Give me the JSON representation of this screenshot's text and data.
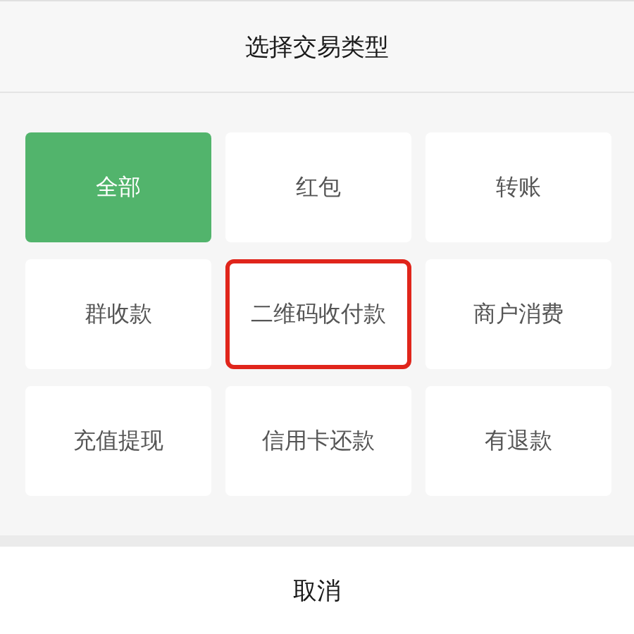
{
  "title": "选择交易类型",
  "options": [
    {
      "label": "全部",
      "selected": true,
      "highlighted": false
    },
    {
      "label": "红包",
      "selected": false,
      "highlighted": false
    },
    {
      "label": "转账",
      "selected": false,
      "highlighted": false
    },
    {
      "label": "群收款",
      "selected": false,
      "highlighted": false
    },
    {
      "label": "二维码收付款",
      "selected": false,
      "highlighted": true
    },
    {
      "label": "商户消费",
      "selected": false,
      "highlighted": false
    },
    {
      "label": "充值提现",
      "selected": false,
      "highlighted": false
    },
    {
      "label": "信用卡还款",
      "selected": false,
      "highlighted": false
    },
    {
      "label": "有退款",
      "selected": false,
      "highlighted": false
    }
  ],
  "cancel": "取消"
}
